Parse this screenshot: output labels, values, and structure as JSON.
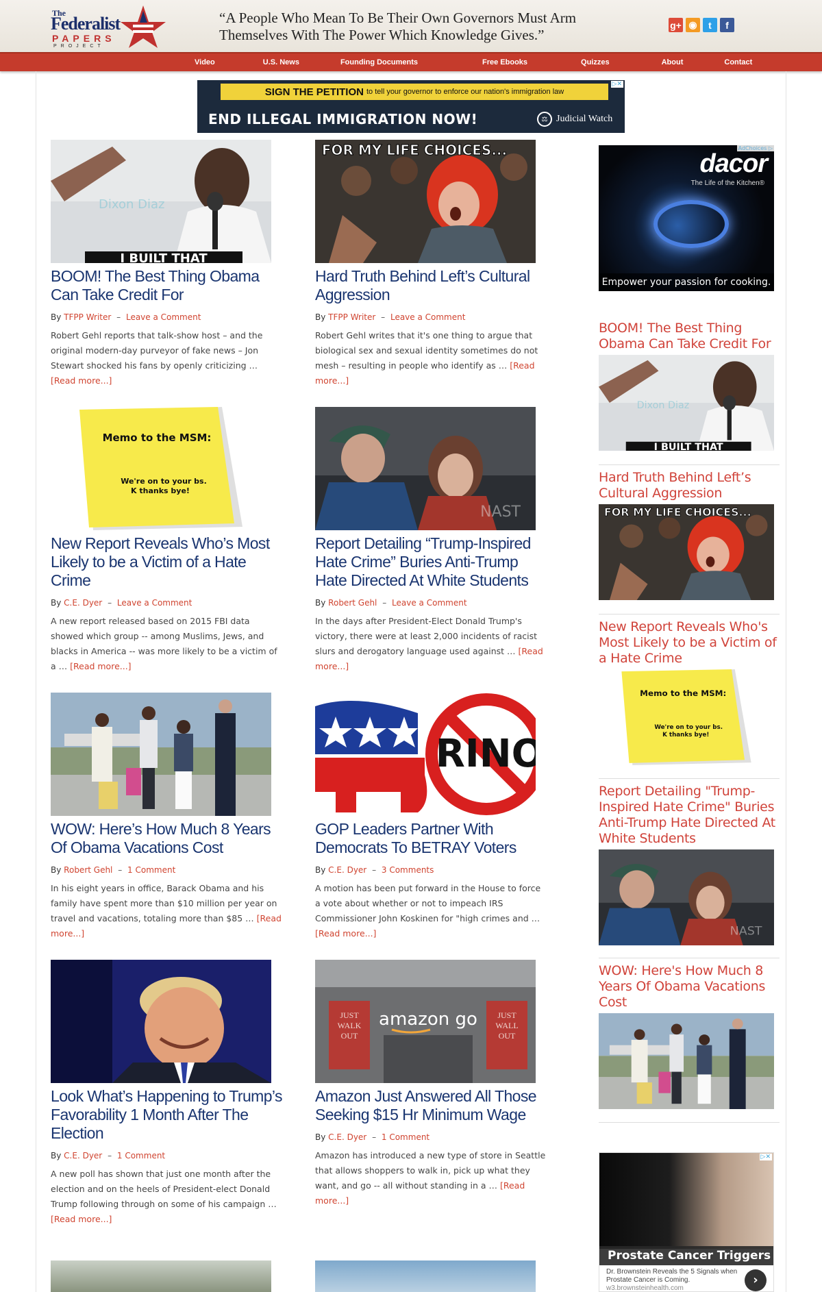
{
  "header": {
    "logo": {
      "the": "The",
      "federalist": "Federalist",
      "papers": "PAPERS",
      "project": "PROJECT"
    },
    "quote_line1": "“A People Who Mean To Be Their Own Governors Must Arm",
    "quote_line2": "Themselves With The Power Which Knowledge Gives.”",
    "social": [
      {
        "icon": "google-plus-icon",
        "glyph": "g+",
        "color": "#dd4b39"
      },
      {
        "icon": "rss-icon",
        "glyph": "◉",
        "color": "#f49a23"
      },
      {
        "icon": "twitter-icon",
        "glyph": "t",
        "color": "#2ea0e8"
      },
      {
        "icon": "facebook-icon",
        "glyph": "f",
        "color": "#3b5998"
      }
    ]
  },
  "nav": {
    "items": [
      "Video",
      "U.S. News",
      "Founding Documents",
      "Free Ebooks",
      "Quizzes",
      "About",
      "Contact"
    ]
  },
  "banner_ad": {
    "sign": "SIGN THE PETITION",
    "sign_rest": "to tell your governor to enforce our nation's immigration law",
    "main": "END ILLEGAL IMMIGRATION NOW!",
    "sponsor": "Judicial Watch",
    "adchoices": "▷✕"
  },
  "articles": [
    {
      "title": "BOOM! The Best Thing Obama Can Take Credit For",
      "author": "TFPP Writer",
      "comments": "Leave a Comment",
      "excerpt": "Robert Gehl reports that talk-show host – and the original modern-day purveyor of fake news – Jon Stewart shocked his fans by openly criticizing …",
      "more": "[Read more...]",
      "image": "obama-mic",
      "image_caption": "I BUILT THAT",
      "watermark": "Dixon Diaz"
    },
    {
      "title": "Hard Truth Behind Left’s Cultural Aggression",
      "author": "TFPP Writer",
      "comments": "Leave a Comment",
      "excerpt": "Robert Gehl writes that it's one thing to argue that biological sex and sexual identity sometimes do not mesh – resulting in people who identify as …",
      "more": "[Read more...]",
      "image": "protester",
      "image_caption": "FOR MY LIFE CHOICES..."
    },
    {
      "title": "New Report Reveals Who’s Most Likely to be a Victim of a Hate Crime",
      "author": "C.E. Dyer",
      "comments": "Leave a Comment",
      "excerpt": "A new report released based on 2015 FBI data showed which group -- among Muslims, Jews, and blacks in America -- was more likely to be a victim of a …",
      "more": "[Read more...]",
      "image": "memo",
      "memo_title": "Memo to the MSM:",
      "memo_body": "We're on to your bs. K thanks bye!"
    },
    {
      "title": "Report Detailing “Trump-Inspired Hate Crime” Buries Anti-Trump Hate Directed At White Students",
      "author": "Robert Gehl",
      "comments": "Leave a Comment",
      "excerpt": "In the days after President-Elect Donald Trump's victory, there were at least 2,000 incidents of racist slurs and derogatory language used against …",
      "more": "[Read more...]",
      "image": "students"
    },
    {
      "title": "WOW: Here’s How Much 8 Years Of Obama Vacations Cost",
      "author": "Robert Gehl",
      "comments": "1 Comment",
      "excerpt": "In his eight years in office, Barack Obama and his family have spent more than $10 million per year on travel and vacations, totaling more than $85 …",
      "more": "[Read more...]",
      "image": "family-tarmac"
    },
    {
      "title": "GOP Leaders Partner With Democrats To BETRAY Voters",
      "author": "C.E. Dyer",
      "comments": "3 Comments",
      "excerpt": "A motion has been put forward in the House to force a vote about whether or not to impeach IRS Commissioner John Koskinen for \"high crimes and …",
      "more": "[Read more...]",
      "image": "rino",
      "rino_text": "RINO"
    },
    {
      "title": "Look What’s Happening to Trump’s Favorability 1 Month After The Election",
      "author": "C.E. Dyer",
      "comments": "1 Comment",
      "excerpt": "A new poll has shown that just one month after the election and on the heels of President-elect Donald Trump following through on some of his campaign …",
      "more": "[Read more...]",
      "image": "trump"
    },
    {
      "title": "Amazon Just Answered All Those Seeking $15 Hr Minimum Wage",
      "author": "C.E. Dyer",
      "comments": "1 Comment",
      "excerpt": "Amazon has introduced a new type of store in Seattle that allows shoppers to walk in, pick up what they want, and go  -- all without standing in a …",
      "more": "[Read more...]",
      "image": "amazon-go",
      "store_text": "amazon go",
      "sign_text": "JUST WALK OUT"
    }
  ],
  "byline_prefix": "By",
  "sidebar": {
    "ad": {
      "brand": "dacor",
      "tagline": "The Life of the Kitchen®",
      "cta": "Empower your passion for cooking.",
      "adchoices": "AdChoices ▷"
    },
    "items": [
      {
        "title": "BOOM! The Best Thing Obama Can Take Credit For",
        "image": "obama-mic"
      },
      {
        "title": "Hard Truth Behind Left’s Cultural Aggression",
        "image": "protester"
      },
      {
        "title": "New Report Reveals Who's Most Likely to be a Victim of a Hate Crime",
        "image": "memo"
      },
      {
        "title": "Report Detailing \"Trump-Inspired Hate Crime\" Buries Anti-Trump Hate Directed At White Students",
        "image": "students"
      },
      {
        "title": "WOW: Here's How Much 8 Years Of Obama Vacations Cost",
        "image": "family-tarmac"
      }
    ],
    "ad2": {
      "headline": "Prostate Cancer Triggers",
      "sub": "Dr. Brownstein Reveals the 5 Signals when Prostate Cancer is Coming.",
      "url": "w3.brownsteinhealth.com",
      "adchoices": "▷✕"
    }
  },
  "colors": {
    "nav": "#c53b2c",
    "title": "#1a3570",
    "accent": "#d04430",
    "sidebar_title": "#d0433a"
  }
}
